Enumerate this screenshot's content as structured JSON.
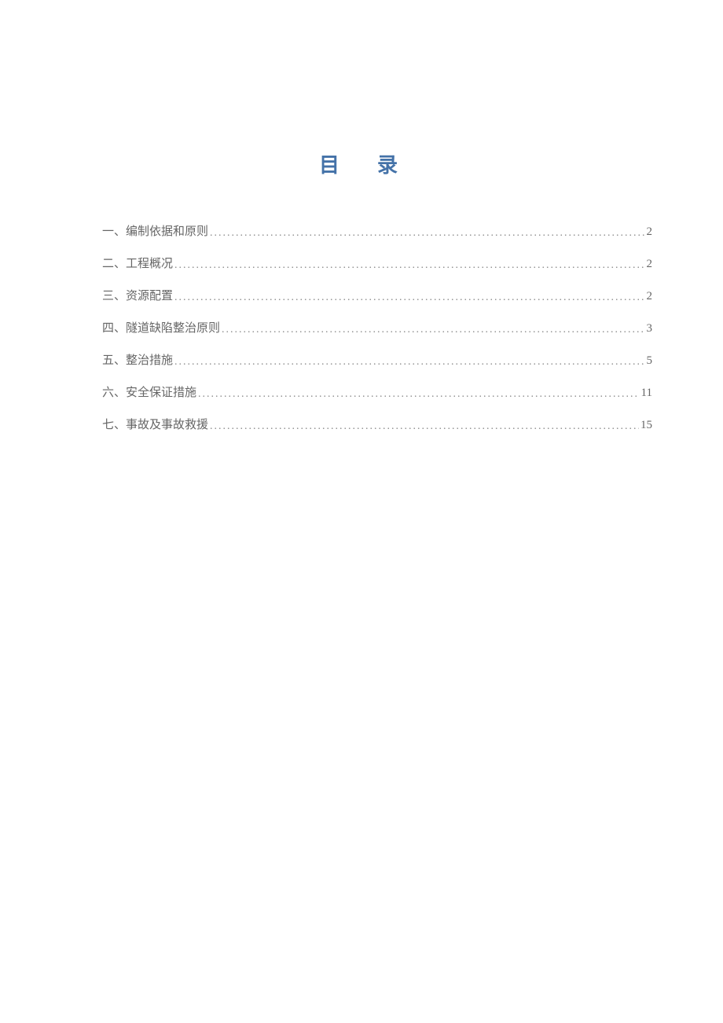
{
  "title": "目录",
  "toc": {
    "entries": [
      {
        "label": "一、编制依据和原则",
        "page": "2"
      },
      {
        "label": "二、工程概况",
        "page": "2"
      },
      {
        "label": "三、资源配置",
        "page": "2"
      },
      {
        "label": "四、隧道缺陷整治原则",
        "page": "3"
      },
      {
        "label": "五、整治措施",
        "page": "5"
      },
      {
        "label": "六、安全保证措施",
        "page": "11"
      },
      {
        "label": "七、事故及事故救援",
        "page": "15"
      }
    ]
  }
}
